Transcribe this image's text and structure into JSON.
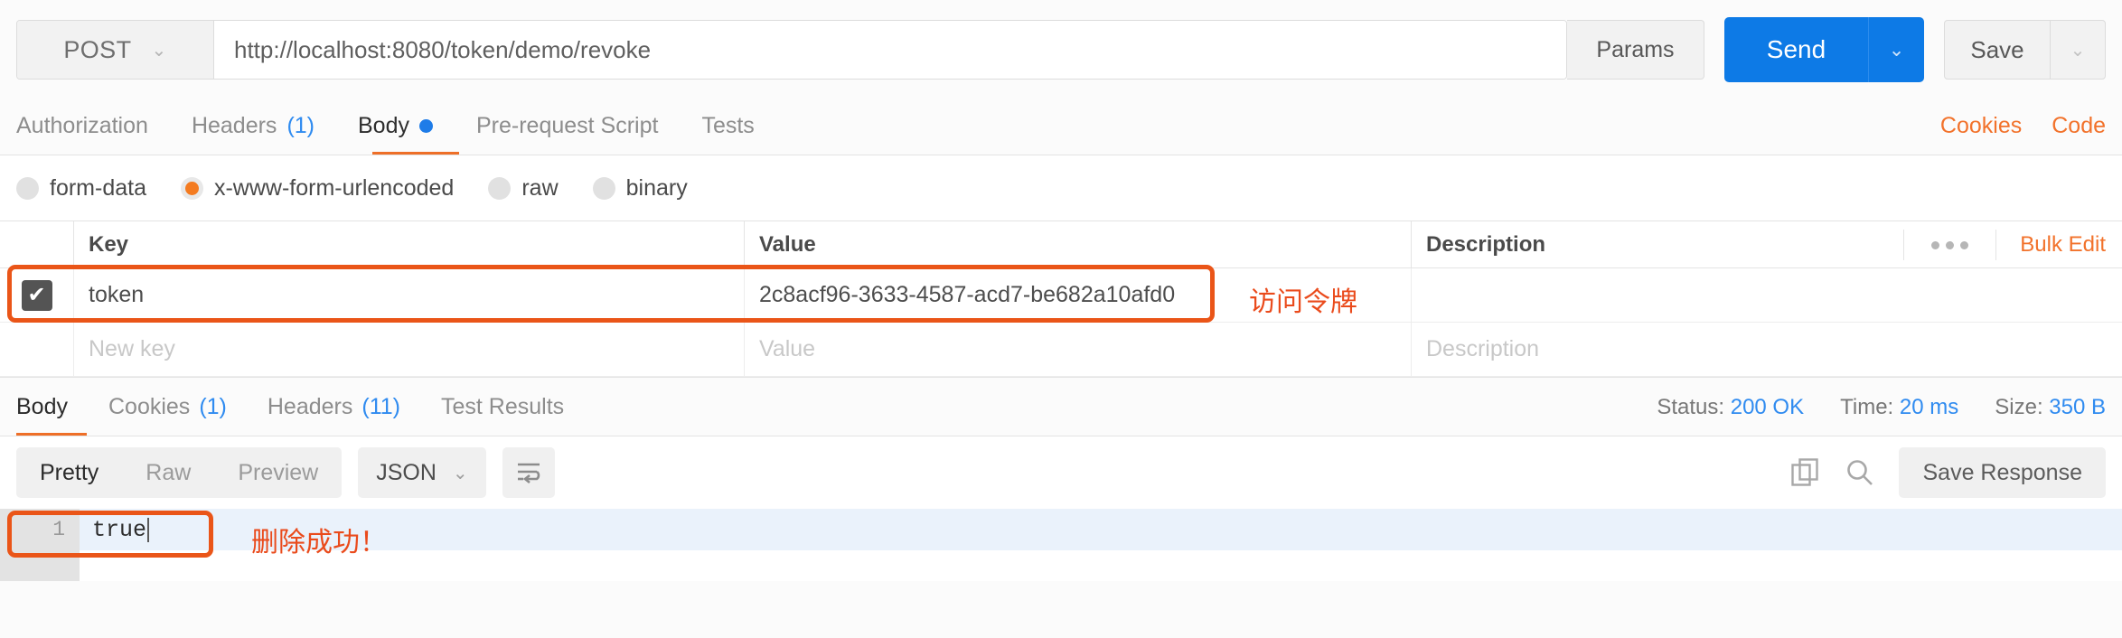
{
  "request_bar": {
    "method": "POST",
    "method_caret": "⌄",
    "url": "http://localhost:8080/token/demo/revoke",
    "params_label": "Params",
    "send_label": "Send",
    "send_caret": "⌄",
    "save_label": "Save",
    "save_caret": "⌄"
  },
  "request_tabs": {
    "items": [
      {
        "label": "Authorization",
        "count": "",
        "dot": false,
        "active": false
      },
      {
        "label": "Headers",
        "count": "(1)",
        "dot": false,
        "active": false
      },
      {
        "label": "Body",
        "count": "",
        "dot": true,
        "active": true
      },
      {
        "label": "Pre-request Script",
        "count": "",
        "dot": false,
        "active": false
      },
      {
        "label": "Tests",
        "count": "",
        "dot": false,
        "active": false
      }
    ],
    "cookies_link": "Cookies",
    "code_link": "Code"
  },
  "body_types": {
    "options": [
      {
        "label": "form-data",
        "selected": false
      },
      {
        "label": "x-www-form-urlencoded",
        "selected": true
      },
      {
        "label": "raw",
        "selected": false
      },
      {
        "label": "binary",
        "selected": false
      }
    ]
  },
  "kv_table": {
    "headers": {
      "key": "Key",
      "value": "Value",
      "description": "Description"
    },
    "rows": [
      {
        "checked": true,
        "check_glyph": "✔",
        "key": "token",
        "value": "2c8acf96-3633-4587-acd7-be682a10afd0",
        "description": ""
      }
    ],
    "placeholder_row": {
      "key": "New key",
      "value": "Value",
      "description": "Description"
    },
    "bulk_edit_label": "Bulk Edit"
  },
  "annotations": {
    "token_note": "访问令牌",
    "result_note": "删除成功！",
    "box_color": "#ea5518",
    "text_color": "#ea4b1c"
  },
  "response_tabs": {
    "items": [
      {
        "label": "Body",
        "count": "",
        "active": true
      },
      {
        "label": "Cookies",
        "count": "(1)",
        "active": false
      },
      {
        "label": "Headers",
        "count": "(11)",
        "active": false
      },
      {
        "label": "Test Results",
        "count": "",
        "active": false
      }
    ],
    "meta": {
      "status_label": "Status:",
      "status_value": "200 OK",
      "time_label": "Time:",
      "time_value": "20 ms",
      "size_label": "Size:",
      "size_value": "350 B"
    }
  },
  "response_toolbar": {
    "view_modes": [
      {
        "label": "Pretty",
        "active": true
      },
      {
        "label": "Raw",
        "active": false
      },
      {
        "label": "Preview",
        "active": false
      }
    ],
    "format": "JSON",
    "format_caret": "⌄",
    "save_response_label": "Save Response"
  },
  "response_body": {
    "line_number": "1",
    "content": "true"
  }
}
